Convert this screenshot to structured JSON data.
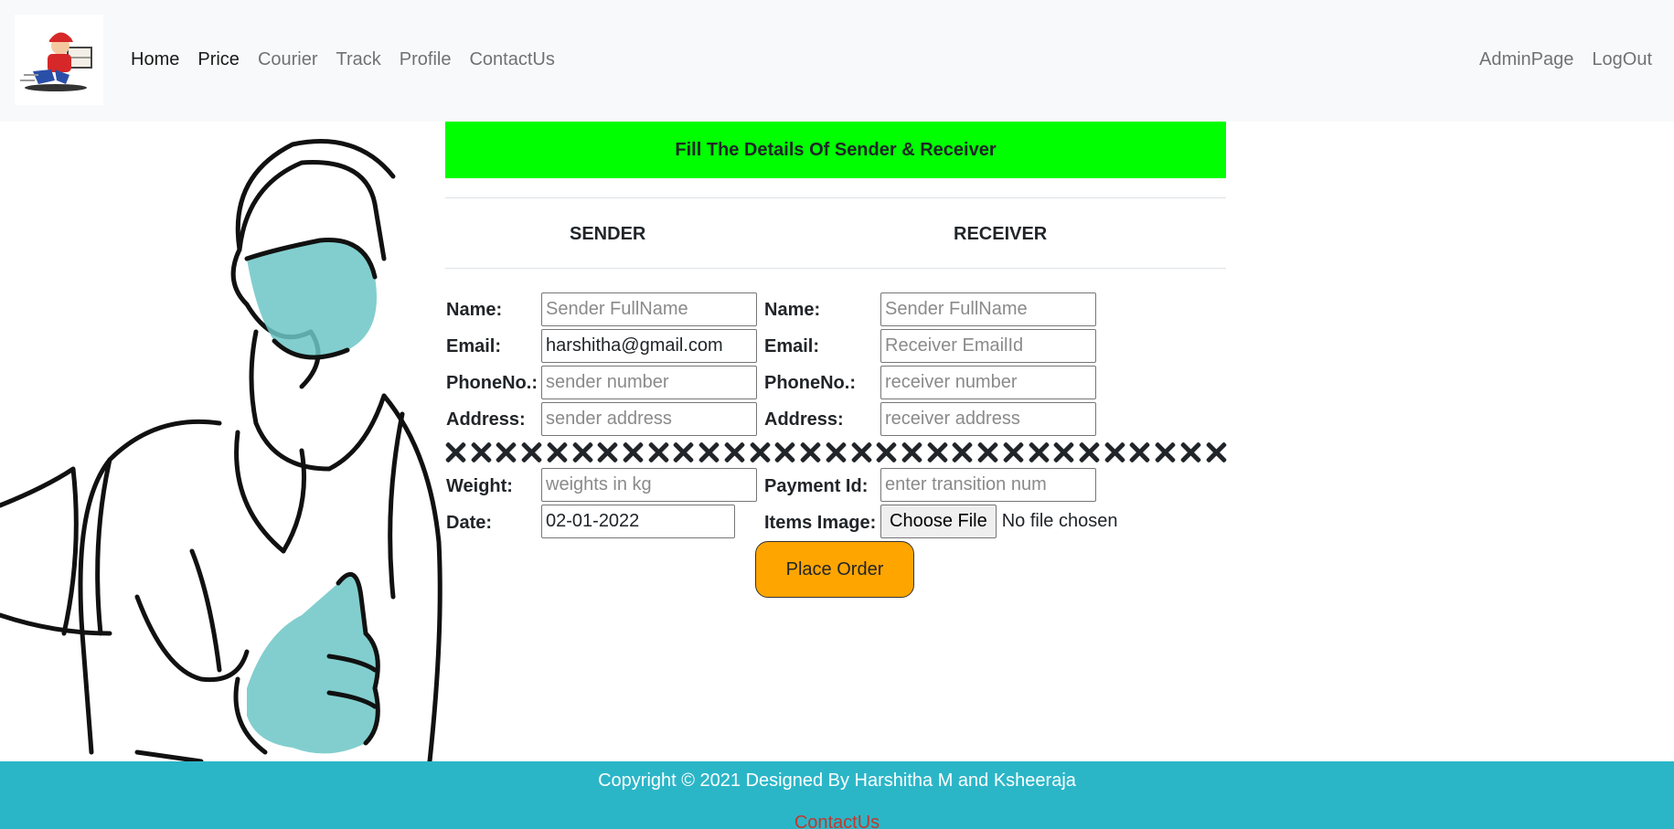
{
  "nav": {
    "left": [
      "Home",
      "Price",
      "Courier",
      "Track",
      "Profile",
      "ContactUs"
    ],
    "right": [
      "AdminPage",
      "LogOut"
    ]
  },
  "banner": "Fill The Details Of Sender & Receiver",
  "sender_heading": "SENDER",
  "receiver_heading": "RECEIVER",
  "labels": {
    "name": "Name:",
    "email": "Email:",
    "phone": "PhoneNo.:",
    "address": "Address:",
    "weight": "Weight:",
    "date": "Date:",
    "payment": "Payment Id:",
    "items_image": "Items Image:"
  },
  "sender": {
    "name_placeholder": "Sender FullName",
    "email_value": "harshitha@gmail.com",
    "phone_placeholder": "sender number",
    "address_placeholder": "sender address"
  },
  "receiver": {
    "name_placeholder": "Sender FullName",
    "email_placeholder": "Receiver EmailId",
    "phone_placeholder": "receiver number",
    "address_placeholder": "receiver address"
  },
  "weight_placeholder": "weights in kg",
  "date_value": "02-01-2022",
  "payment_placeholder": "enter transition num",
  "file_button": "Choose File",
  "file_status": "No file chosen",
  "place_order": "Place Order",
  "footer": {
    "copyright": "Copyright © 2021 Designed By Harshitha M and Ksheeraja",
    "contact": "ContactUs"
  },
  "colors": {
    "banner": "#00ff00",
    "button": "#ffa500",
    "footer": "#2bb6c8",
    "mask": "#6cc6c6"
  }
}
